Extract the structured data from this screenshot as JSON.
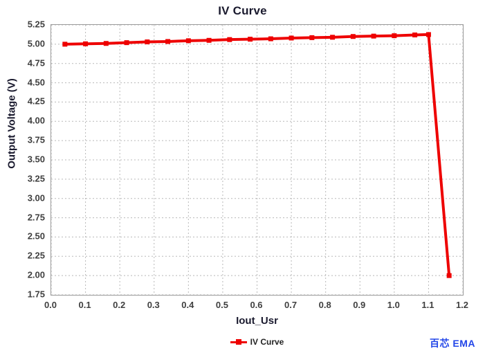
{
  "chart_data": {
    "type": "line",
    "title": "IV Curve",
    "xlabel": "Iout_Usr",
    "ylabel": "Output Voltage (V)",
    "xlim": [
      0.0,
      1.2
    ],
    "ylim": [
      1.75,
      5.25
    ],
    "xticks": [
      "0.0",
      "0.1",
      "0.2",
      "0.3",
      "0.4",
      "0.5",
      "0.6",
      "0.7",
      "0.8",
      "0.9",
      "1.0",
      "1.1",
      "1.2"
    ],
    "yticks": [
      "1.75",
      "2.00",
      "2.25",
      "2.50",
      "2.75",
      "3.00",
      "3.25",
      "3.50",
      "3.75",
      "4.00",
      "4.25",
      "4.50",
      "4.75",
      "5.00",
      "5.25"
    ],
    "grid": true,
    "legend_position": "bottom-center",
    "series": [
      {
        "name": "IV Curve",
        "color": "#ee0000",
        "marker": "square",
        "x": [
          0.04,
          0.1,
          0.16,
          0.22,
          0.28,
          0.34,
          0.4,
          0.46,
          0.52,
          0.58,
          0.64,
          0.7,
          0.76,
          0.82,
          0.88,
          0.94,
          1.0,
          1.06,
          1.1,
          1.16
        ],
        "y": [
          5.0,
          5.005,
          5.01,
          5.02,
          5.03,
          5.035,
          5.045,
          5.05,
          5.06,
          5.065,
          5.07,
          5.08,
          5.085,
          5.09,
          5.1,
          5.105,
          5.11,
          5.12,
          5.125,
          2.0
        ]
      }
    ]
  },
  "legend": {
    "entries": [
      {
        "label": "IV Curve"
      }
    ]
  },
  "watermark": {
    "text": "百芯 EMA"
  }
}
